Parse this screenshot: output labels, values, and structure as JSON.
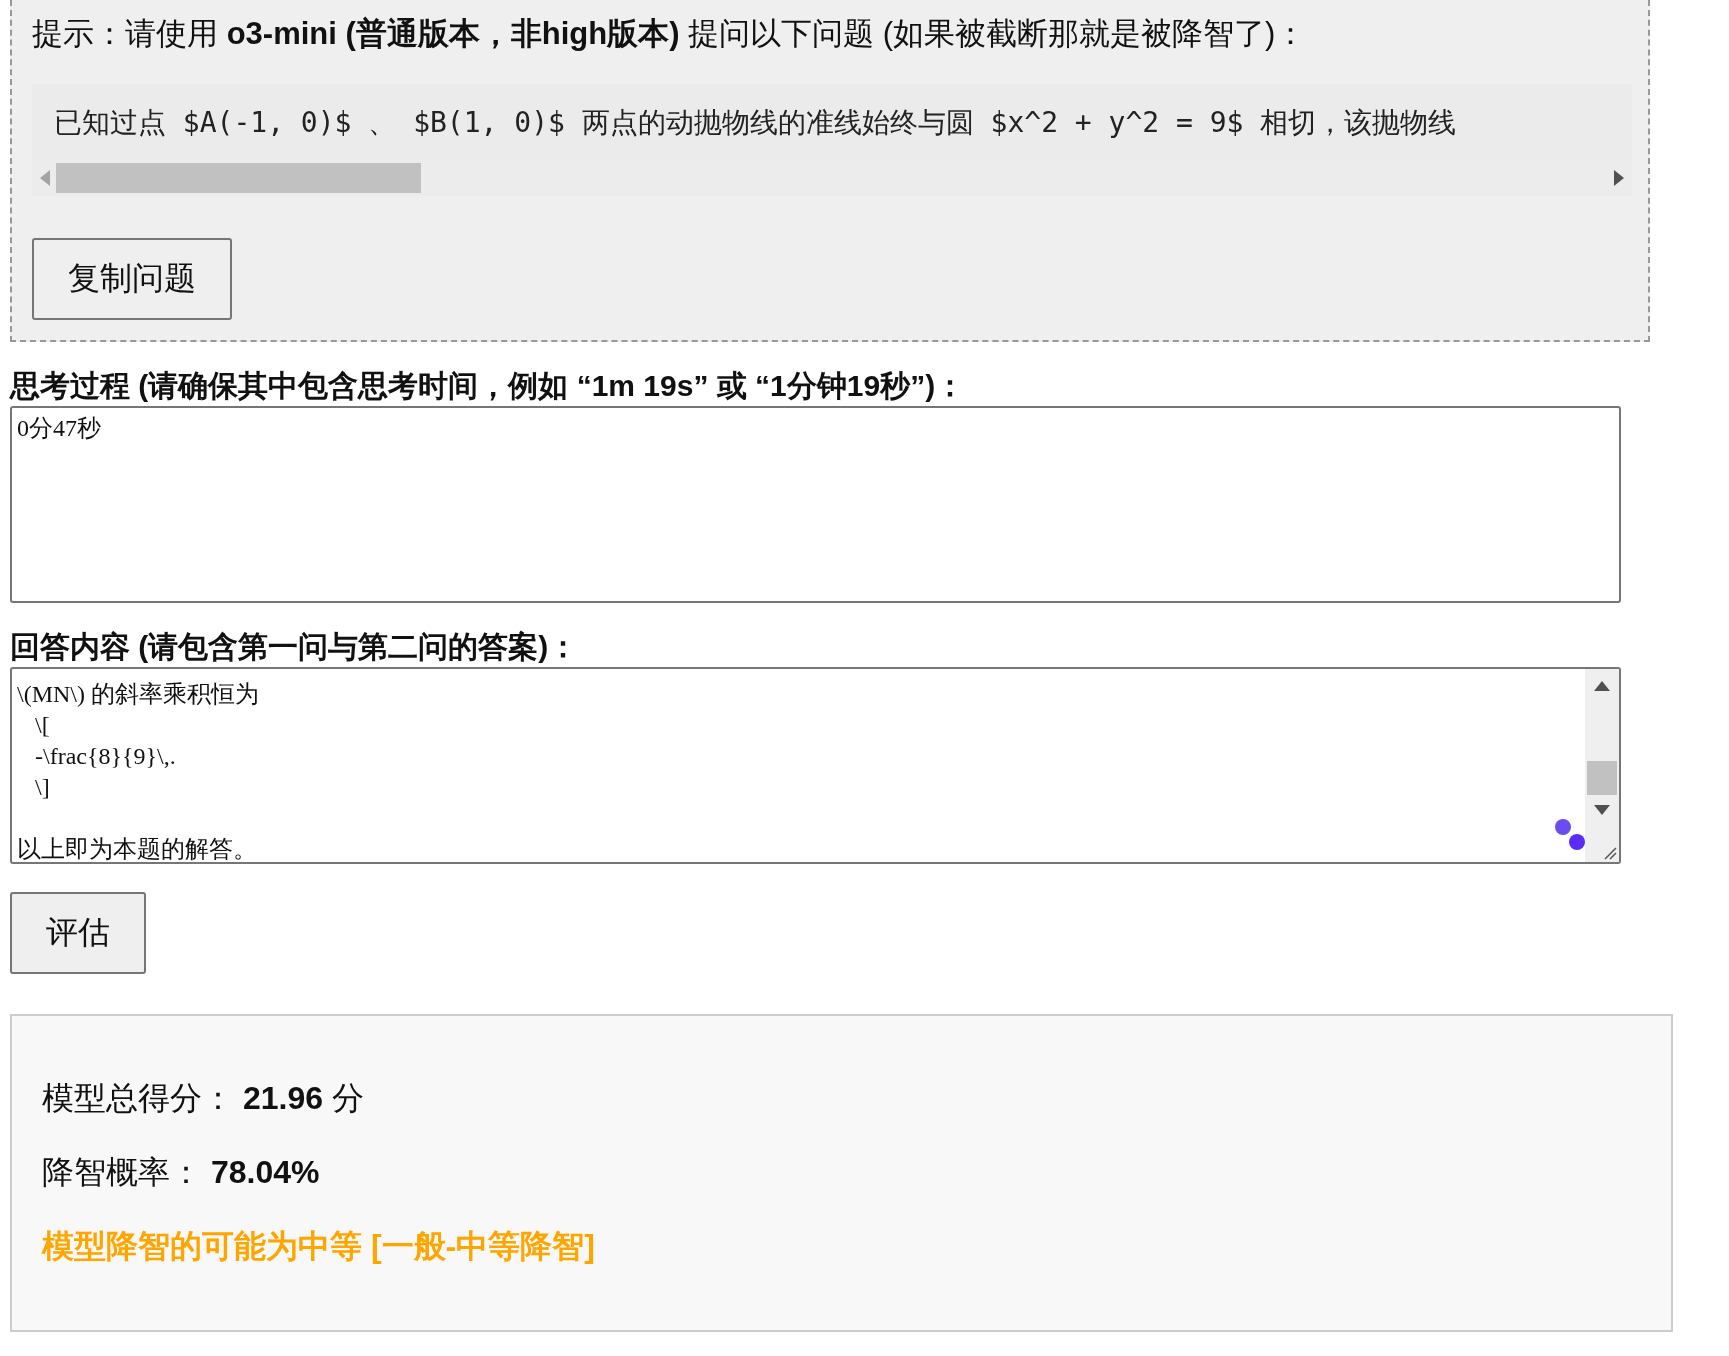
{
  "prompt_panel": {
    "hint": "提示：请使用 **o3-mini (普通版本，非high版本)** 提问以下问题 (如果被截断那就是被降智了)：",
    "question": "已知过点 $A(-1, 0)$ 、 $B(1, 0)$ 两点的动抛物线的准线始终与圆 $x^2 + y^2 = 9$ 相切，该抛物线",
    "copy_button": "复制问题"
  },
  "thinking": {
    "label": "思考过程 (请确保其中包含思考时间，例如 “1m 19s” 或 “1分钟19秒”)：",
    "value": "0分47秒"
  },
  "answer": {
    "label": "回答内容 (请包含第一问与第二问的答案)：",
    "lines": [
      "\\(MN\\) 的斜率乘积恒为",
      "   \\[",
      "   -\\frac{8}{9}\\,.",
      "   \\]"
    ],
    "closing": "以上即为本题的解答。"
  },
  "evaluate_button": "评估",
  "result": {
    "score": "模型总得分： **21.96** 分",
    "probability": "降智概率： **78.04%**",
    "verdict": {
      "text": "模型降智的可能为中等 [一般-中等降智]",
      "highlighted": true
    }
  }
}
